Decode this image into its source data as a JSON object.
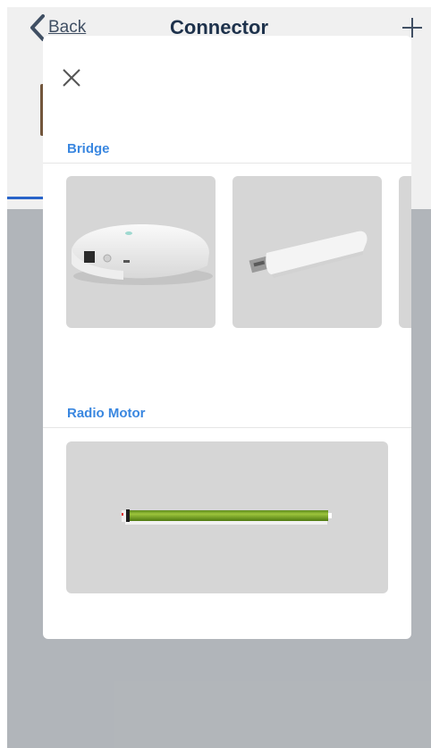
{
  "nav": {
    "back_label": "Back",
    "title": "Connector",
    "plus_icon": "plus-icon",
    "back_icon": "chevron-left-icon"
  },
  "modal": {
    "close_icon": "close-icon",
    "sections": [
      {
        "title": "Bridge",
        "items": [
          "bridge-hub-device",
          "usb-bridge-dongle",
          "bridge-device-partial"
        ]
      },
      {
        "title": "Radio Motor",
        "items": [
          "tubular-radio-motor"
        ]
      }
    ]
  },
  "colors": {
    "accent": "#3a87e0",
    "nav_title": "#1f3550",
    "card_bg": "#d6d6d6",
    "background_gray": "#bdc1c6",
    "motor_green": "#7aa52a"
  }
}
